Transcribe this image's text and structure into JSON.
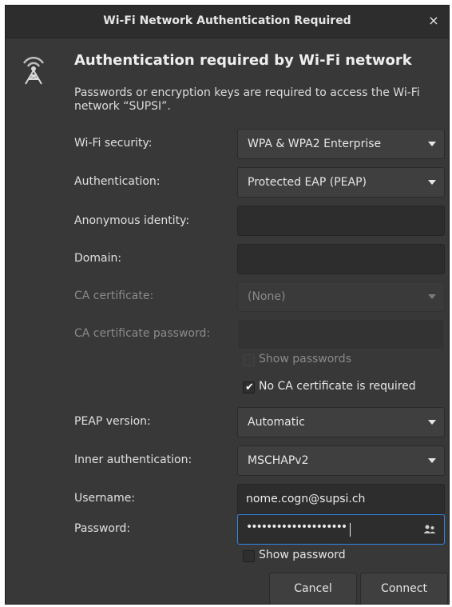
{
  "window": {
    "title": "Wi-Fi Network Authentication Required",
    "close_glyph": "×"
  },
  "header": {
    "icon": "wifi-tower-icon",
    "heading": "Authentication required by Wi-Fi network",
    "description": "Passwords or encryption keys are required to access the Wi-Fi network “SUPSI”."
  },
  "form": {
    "wifi_security": {
      "label": "Wi-Fi security:",
      "value": "WPA & WPA2 Enterprise"
    },
    "authentication": {
      "label": "Authentication:",
      "value": "Protected EAP (PEAP)"
    },
    "anonymous_identity": {
      "label": "Anonymous identity:",
      "value": ""
    },
    "domain": {
      "label": "Domain:",
      "value": ""
    },
    "ca_certificate": {
      "label": "CA certificate:",
      "value": "(None)"
    },
    "ca_certificate_password": {
      "label": "CA certificate password:",
      "value": ""
    },
    "show_passwords": {
      "label": "Show passwords",
      "checked": false
    },
    "no_ca_cert": {
      "label": "No CA certificate is required",
      "checked": true
    },
    "peap_version": {
      "label": "PEAP version:",
      "value": "Automatic"
    },
    "inner_authentication": {
      "label": "Inner authentication:",
      "value": "MSCHAPv2"
    },
    "username": {
      "label": "Username:",
      "value": "nome.cogn@supsi.ch"
    },
    "password": {
      "label": "Password:",
      "masked_value": "••••••••••••••••••••"
    },
    "show_password": {
      "label": "Show password",
      "checked": false
    }
  },
  "buttons": {
    "cancel": "Cancel",
    "connect": "Connect"
  },
  "colors": {
    "window_bg": "#383838",
    "titlebar_bg": "#2d2d2d",
    "focus_accent": "#3584e4"
  }
}
